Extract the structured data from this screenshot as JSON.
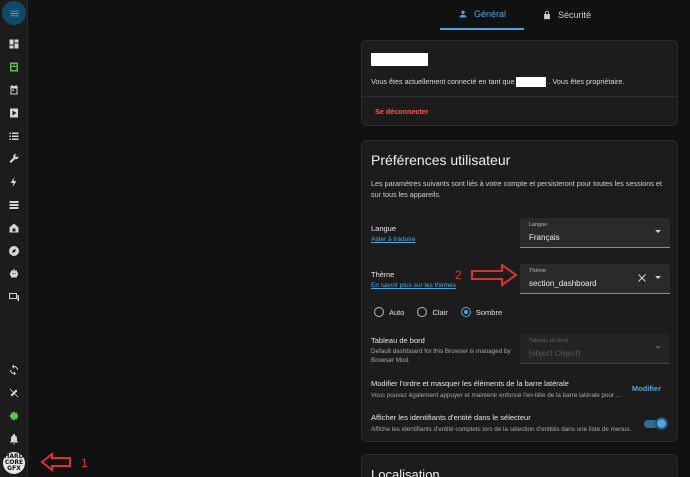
{
  "tabs": [
    {
      "label": "Général",
      "icon": "account-icon",
      "active": true
    },
    {
      "label": "Sécurité",
      "icon": "lock-icon",
      "active": false
    }
  ],
  "sidebar": {
    "items": [
      "menu-icon",
      "dashboard-icon",
      "energy-icon",
      "calendar-icon",
      "media-icon",
      "list-icon",
      "wrench-icon",
      "lightning-icon",
      "server-icon",
      "home-icon",
      "compass-icon",
      "robot-icon",
      "devices-icon",
      "sync-icon",
      "tools-icon",
      "gear-icon",
      "bell-icon"
    ],
    "avatar_text": [
      "HARD",
      "CORE",
      "GFX"
    ]
  },
  "account": {
    "connected_prefix": "Vous êtes actuellement connecté en tant que",
    "connected_suffix": ". Vous êtes propriétaire.",
    "logout": "Se déconnecter"
  },
  "preferences": {
    "title": "Préférences utilisateur",
    "description": "Les paramètres suivants sont liés à votre compte et persisteront pour toutes les sessions et sur tous les appareils.",
    "language": {
      "label": "Langue",
      "link": "Aider à traduire",
      "select_label": "Langue",
      "select_value": "Français"
    },
    "theme": {
      "label": "Thème",
      "link": "En savoir plus sur les thèmes",
      "select_label": "Thème",
      "select_value": "section_dashboard",
      "modes": [
        {
          "label": "Auto",
          "selected": false
        },
        {
          "label": "Clair",
          "selected": false
        },
        {
          "label": "Sombre",
          "selected": true
        }
      ]
    },
    "dashboard": {
      "label": "Tableau de bord",
      "sub": "Default dashboard for this Browser is managed by Browser Mod.",
      "select_label": "Tableau de bord",
      "select_value": "[object Object]"
    },
    "sidebar_order": {
      "label": "Modifier l'ordre et masquer les éléments de la barre latérale",
      "sub": "Vous pouvez également appuyer et maintenir enfoncé l'en-tête de la barre latérale pour ...",
      "button": "Modifier"
    },
    "entity_ids": {
      "label": "Afficher les identifiants d'entité dans le sélecteur",
      "sub": "Affiche les identifiants d'entité complets lors de la sélection d'entités dans une liste de menus.",
      "enabled": true
    }
  },
  "localisation": {
    "title": "Localisation"
  },
  "annotations": {
    "first": "1",
    "second": "2"
  },
  "colors": {
    "accent": "#4aa8e0",
    "danger": "#ff5050",
    "annotation": "#e03030",
    "energy": "#5ec34b"
  }
}
